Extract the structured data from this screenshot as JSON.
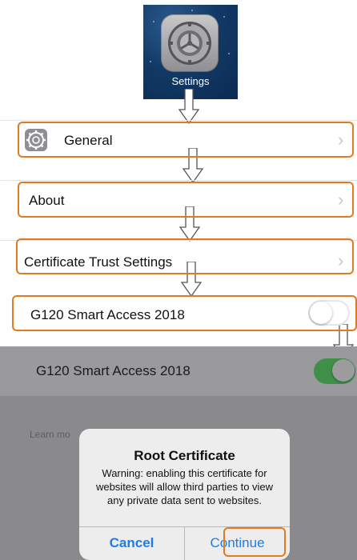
{
  "app_icon": {
    "label": "Settings"
  },
  "rows": {
    "general": {
      "label": "General",
      "chevron": "›"
    },
    "about": {
      "label": "About",
      "chevron": "›"
    },
    "cert_trust": {
      "label": "Certificate Trust Settings",
      "chevron": "›"
    },
    "cert_item": {
      "label": "G120 Smart Access 2018",
      "toggle_state": "off"
    }
  },
  "dimmed_view": {
    "row_label": "G120 Smart Access 2018",
    "toggle_state": "on",
    "footer_text": "Learn mo"
  },
  "alert": {
    "title": "Root Certificate",
    "message": "Warning: enabling this certificate for websites will allow third parties to view any private data sent to websites.",
    "cancel_label": "Cancel",
    "continue_label": "Continue"
  },
  "colors": {
    "highlight": "#e07b1f",
    "ios_blue": "#1a7cf2",
    "toggle_on": "#4cd964",
    "toggle_on_dimmed": "#3f8f49"
  }
}
